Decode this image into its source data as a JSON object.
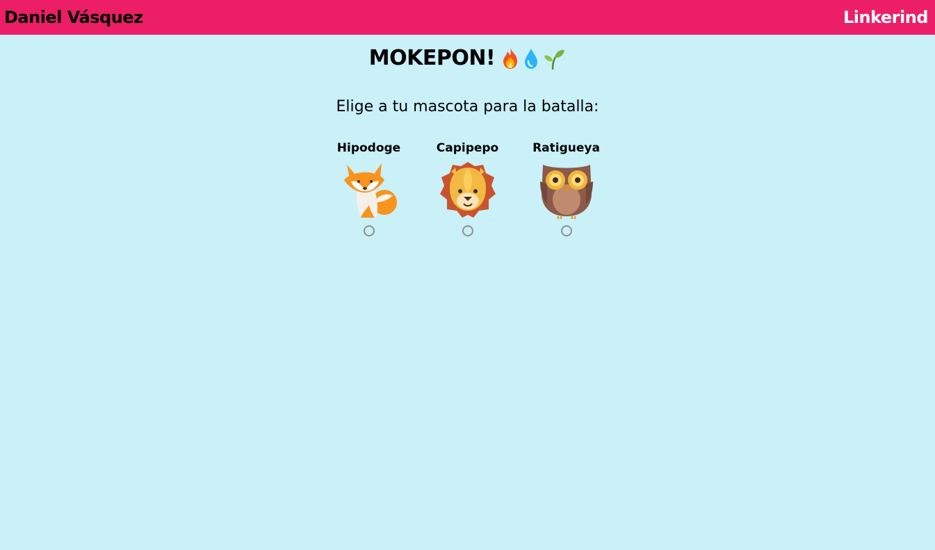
{
  "header": {
    "brand": "Daniel Vásquez",
    "nav_link": "Linkerind"
  },
  "game": {
    "title": "MOKEPON!",
    "title_emojis": [
      "fire-icon",
      "water-drop-icon",
      "seedling-icon"
    ],
    "prompt": "Elige a tu mascota para la batalla:"
  },
  "pets": [
    {
      "name": "Hipodoge",
      "icon": "fox-icon",
      "selected": false
    },
    {
      "name": "Capipepo",
      "icon": "lion-icon",
      "selected": false
    },
    {
      "name": "Ratigueya",
      "icon": "owl-icon",
      "selected": false
    }
  ],
  "colors": {
    "header_bg": "#eb1e66",
    "page_bg": "#caf0f8"
  }
}
